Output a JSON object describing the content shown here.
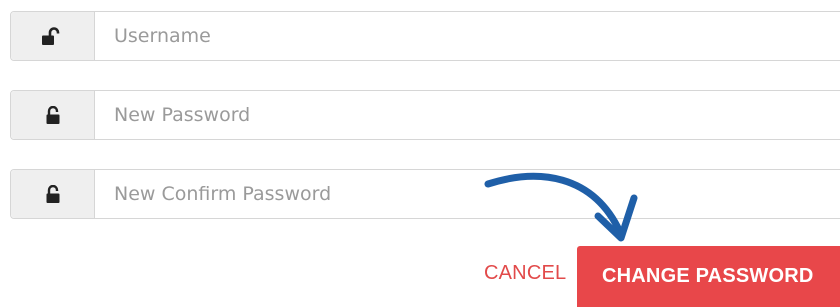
{
  "form": {
    "username": {
      "placeholder": "Username",
      "value": "",
      "icon": "unlock-icon"
    },
    "new_password": {
      "placeholder": "New Password",
      "value": "",
      "icon": "unlock-icon"
    },
    "confirm_password": {
      "placeholder": "New Confirm Password",
      "value": "",
      "icon": "unlock-icon"
    }
  },
  "actions": {
    "cancel_label": "CANCEL",
    "submit_label": "CHANGE PASSWORD"
  },
  "colors": {
    "accent": "#e8474a",
    "cancel_text": "#e24a4a",
    "addon_bg": "#efefef",
    "annotation_arrow": "#1f5fa8"
  }
}
